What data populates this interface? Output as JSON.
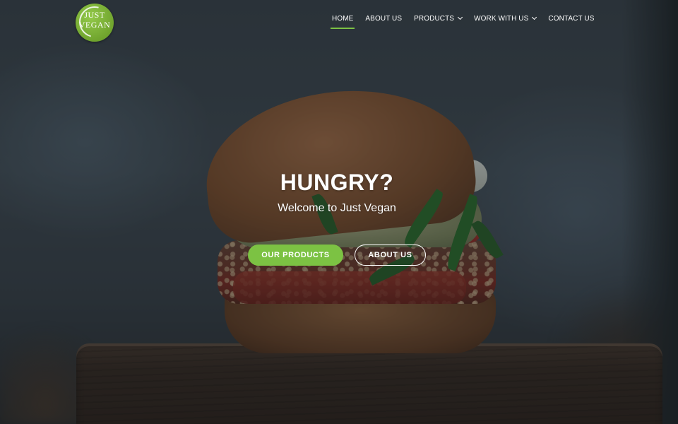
{
  "brand": {
    "line1": "JUST",
    "line2": "VEGAN",
    "color": "#7cc243"
  },
  "nav": {
    "items": [
      {
        "label": "HOME",
        "active": true
      },
      {
        "label": "ABOUT US"
      },
      {
        "label": "PRODUCTS",
        "icon": "chevron-down-icon"
      },
      {
        "label": "WORK WITH US",
        "icon": "chevron-down-icon"
      },
      {
        "label": "CONTACT US"
      }
    ]
  },
  "hero": {
    "title": "HUNGRY?",
    "subtitle": "Welcome to Just Vegan",
    "primary_button": "OUR PRODUCTS",
    "secondary_button": "ABOUT US"
  },
  "colors": {
    "accent": "#7cc243",
    "text": "#ffffff"
  }
}
